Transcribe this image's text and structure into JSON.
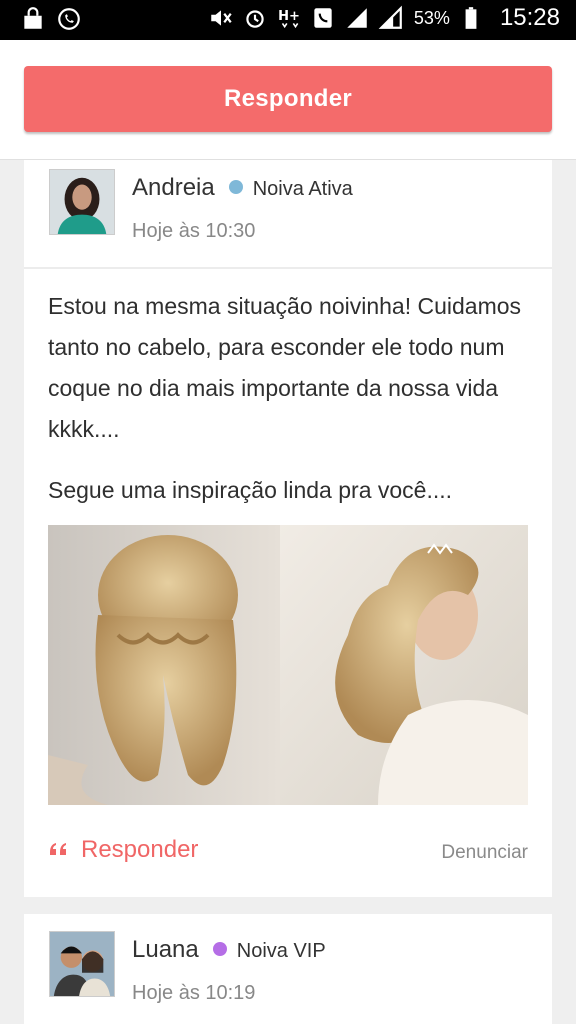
{
  "status_bar": {
    "battery_percent": "53%",
    "time": "15:28",
    "icons": [
      "bag-icon",
      "whatsapp-icon",
      "nfc-icon",
      "mute-icon",
      "alarm-icon",
      "hplus-icon",
      "phone-icon",
      "signal-icon",
      "signal-icon",
      "battery-icon"
    ]
  },
  "header": {
    "reply_label": "Responder"
  },
  "posts": [
    {
      "author": "Andreia",
      "badge": "Noiva Ativa",
      "badge_color": "#7fb8d8",
      "time": "Hoje às 10:30",
      "message": "Estou na mesma situação noivinha! Cuidamos tanto no cabelo, para esconder ele todo num coque no dia mais importante da nossa vida kkkk....",
      "message_2": "Segue uma inspiração linda pra você....",
      "reply_label": "Responder",
      "report_label": "Denunciar"
    },
    {
      "author": "Luana",
      "badge": "Noiva VIP",
      "badge_color": "#b56ee6",
      "time": "Hoje às 10:19"
    }
  ],
  "colors": {
    "accent": "#f46b6b",
    "reply_text": "#f06666"
  }
}
